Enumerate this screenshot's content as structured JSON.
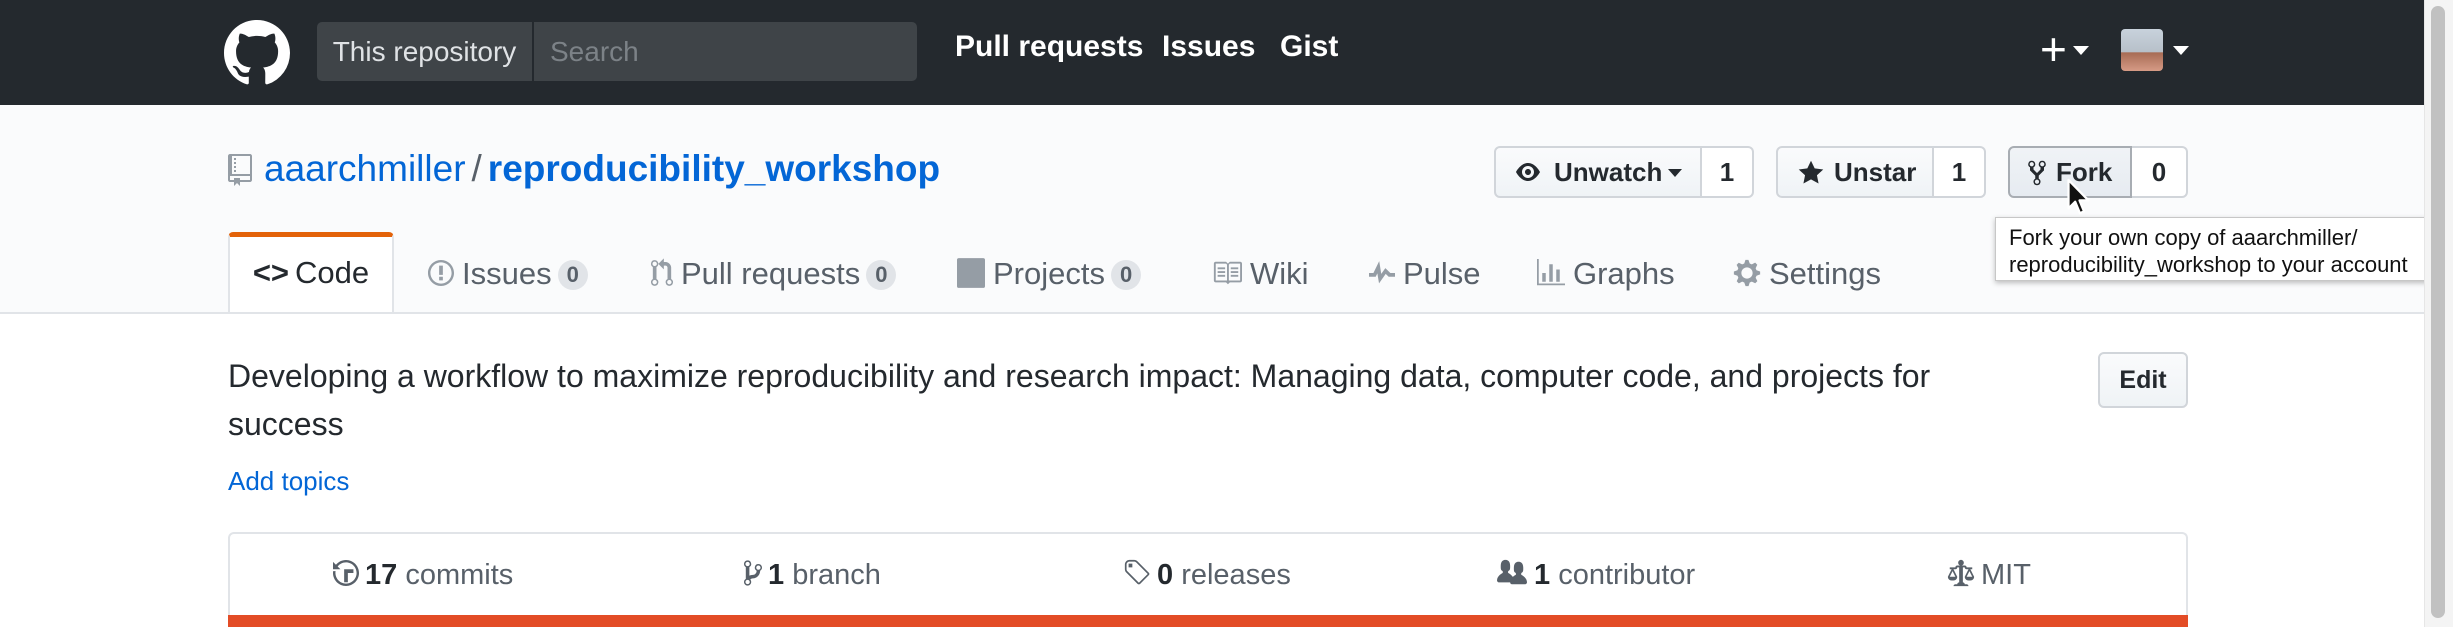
{
  "header": {
    "search_scope": "This repository",
    "search_placeholder": "Search",
    "nav": [
      "Pull requests",
      "Issues",
      "Gist"
    ],
    "plus_label": "+"
  },
  "repo": {
    "owner": "aaarchmiller",
    "separator": "/",
    "name": "reproducibility_workshop"
  },
  "actions": {
    "watch_label": "Unwatch",
    "watch_count": "1",
    "star_label": "Unstar",
    "star_count": "1",
    "fork_label": "Fork",
    "fork_count": "0"
  },
  "tooltip": {
    "line1": "Fork your own copy of aaarchmiller/",
    "line2": "reproducibility_workshop to your account"
  },
  "tabs": [
    {
      "label": "Code",
      "icon": "code-icon"
    },
    {
      "label": "Issues",
      "count": "0",
      "icon": "issue-icon"
    },
    {
      "label": "Pull requests",
      "count": "0",
      "icon": "pull-request-icon"
    },
    {
      "label": "Projects",
      "count": "0",
      "icon": "project-icon"
    },
    {
      "label": "Wiki",
      "icon": "book-icon"
    },
    {
      "label": "Pulse",
      "icon": "pulse-icon"
    },
    {
      "label": "Graphs",
      "icon": "graph-icon"
    },
    {
      "label": "Settings",
      "icon": "gear-icon"
    }
  ],
  "description": {
    "text": "Developing a workflow to maximize reproducibility and research impact: Managing data, computer code, and projects for success",
    "edit_label": "Edit",
    "topics_link": "Add topics"
  },
  "summary": {
    "commits_count": "17",
    "commits_label": "commits",
    "branch_count": "1",
    "branch_label": "branch",
    "releases_count": "0",
    "releases_label": "releases",
    "contributor_count": "1",
    "contributor_label": "contributor",
    "license": "MIT"
  },
  "colors": {
    "header_bg": "#24292e",
    "link": "#0366d6",
    "tab_accent": "#e36209",
    "language_bar": "#e34c26"
  }
}
